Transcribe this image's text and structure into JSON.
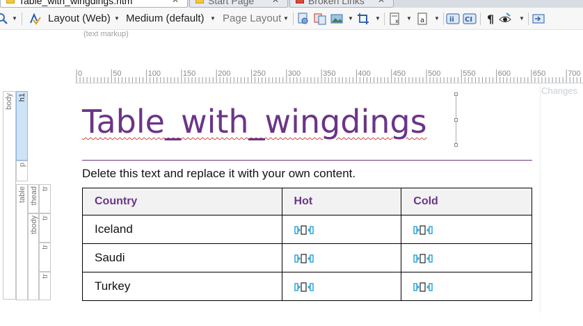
{
  "tabs": [
    {
      "label": "Table_with_wingdings.htm",
      "active": true
    },
    {
      "label": "Start Page",
      "active": false
    },
    {
      "label": "Broken Links",
      "active": false
    }
  ],
  "toolbar": {
    "layout_mode": "Layout (Web)",
    "size_preset": "Medium (default)",
    "page_layout": "Page Layout",
    "icons": [
      "zoom-icon",
      "spellcheck-icon",
      "preview-icon",
      "compare-icon",
      "image-icon",
      "crop-icon",
      "x-format-icon",
      "a-format-icon",
      "ii-icon",
      "ci-icon",
      "pilcrow-icon",
      "eye-icon",
      "insert-icon"
    ]
  },
  "markup_label": "(text markup)",
  "ruler": {
    "labels": [
      "0",
      "50",
      "100",
      "150",
      "200",
      "250",
      "300",
      "350",
      "400",
      "450",
      "500",
      "550",
      "600",
      "650",
      "700"
    ]
  },
  "changes_label": "Changes",
  "structure": {
    "body": "body",
    "h1": "h1",
    "p": "p",
    "table": "table",
    "thead": "thead",
    "tbody": "tbody",
    "tr": "tr"
  },
  "document": {
    "title": "Table_with_wingdings",
    "intro": "Delete this text and replace it with your own content."
  },
  "table": {
    "headers": [
      "Country",
      "Hot",
      "Cold"
    ],
    "rows": [
      [
        "Iceland",
        "glyph-symbol",
        "glyph-symbol"
      ],
      [
        "Saudi",
        "glyph-symbol",
        "glyph-symbol"
      ],
      [
        "Turkey",
        "glyph-symbol",
        "glyph-symbol"
      ]
    ]
  },
  "colors": {
    "heading": "#6b3588",
    "selection": "#cfe3f7",
    "glyph": "#2aa6d9"
  }
}
